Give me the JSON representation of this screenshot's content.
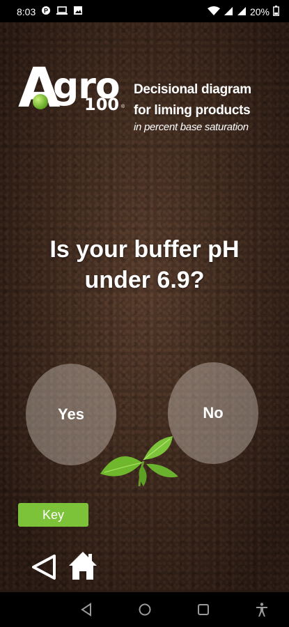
{
  "status_bar": {
    "time": "8:03",
    "battery": "20%",
    "icons": [
      "app-icon",
      "laptop-icon",
      "image-icon",
      "wifi-icon",
      "signal-icon",
      "signal-icon",
      "battery-icon"
    ]
  },
  "header": {
    "logo": {
      "brand": "Agro",
      "number": "100",
      "reg": "®"
    },
    "title_line1": "Decisional diagram",
    "title_line2": "for liming products",
    "subtitle": "in percent base saturation"
  },
  "question": {
    "line1": "Is your buffer pH",
    "line2": "under 6.9?"
  },
  "choices": {
    "yes": "Yes",
    "no": "No"
  },
  "key_button": {
    "label": "Key"
  },
  "bottom_actions": {
    "back_icon": "back-triangle-icon",
    "home_icon": "home-icon"
  },
  "colors": {
    "accent_green": "#7dc33a",
    "soil": "#3b271d"
  },
  "system_nav": [
    "back-icon",
    "home-circle-icon",
    "recents-square-icon",
    "accessibility-icon"
  ]
}
